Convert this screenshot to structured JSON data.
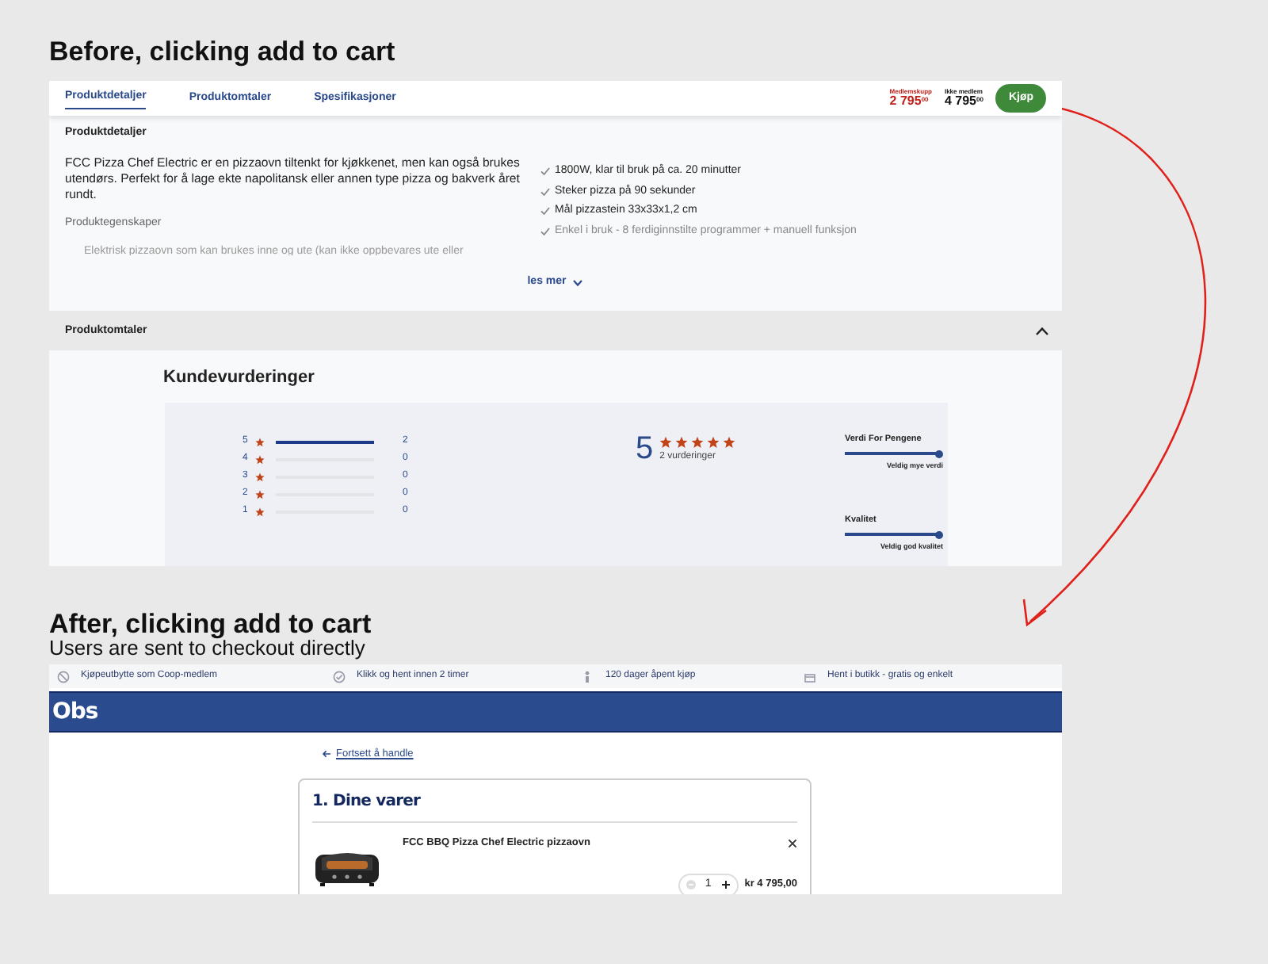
{
  "before": {
    "heading": "Before, clicking add to cart",
    "tabs": [
      {
        "label": "Produktdetaljer",
        "selected": true
      },
      {
        "label": "Produktomtaler",
        "selected": false
      },
      {
        "label": "Spesifikasjoner",
        "selected": false
      }
    ],
    "prices": [
      {
        "kind": "member",
        "label": "Medlemskupp",
        "price": "2 795$^{00}$"
      },
      {
        "kind": "regular",
        "label": "Ikke medlem",
        "price": "4 795$^{00}$"
      }
    ],
    "buy_button": "Kjøp",
    "details": {
      "title": "Produktdetaljer",
      "description": "FCC Pizza Chef Electric er en pizzaovn tiltenkt for kjøkkenet, men kan også brukes utendørs. Perfekt for å lage ekte napolitansk eller annen type pizza og bakverk året rundt.",
      "properties_label": "Produktegenskaper",
      "faded_bullet": "Elektrisk pizzaovn som kan brukes inne og ute (kan ikke oppbevares ute eller",
      "features": [
        {
          "text": "1800W, klar til bruk på ca. 20 minutter",
          "faded": false
        },
        {
          "text": "Steker pizza på 90 sekunder",
          "faded": false
        },
        {
          "text": "Mål pizzastein 33x33x1,2 cm",
          "faded": false
        },
        {
          "text": "Enkel i bruk - 8 ferdiginnstilte programmer + manuell funksjon",
          "faded": true
        }
      ],
      "more_link": "les mer"
    },
    "reviews_header": {
      "title": "Produktomtaler",
      "expanded": true
    },
    "ratings": {
      "title": "Kundevurderinger",
      "distribution": [
        {
          "stars_label": "5",
          "count": "2",
          "level": 1
        },
        {
          "stars_label": "4",
          "count": "0",
          "level": 0
        },
        {
          "stars_label": "3",
          "count": "0",
          "level": 0
        },
        {
          "stars_label": "2",
          "count": "0",
          "level": 0
        },
        {
          "stars_label": "1",
          "count": "0",
          "level": 0
        }
      ],
      "average": "5",
      "stars": 5,
      "count_label": "2 vurderinger",
      "attributes": [
        {
          "name": "Verdi For Pengene",
          "level": 1,
          "caption": "Veldig mye verdi"
        },
        {
          "name": "Kvalitet",
          "level": 1,
          "caption": "Veldig god kvalitet"
        }
      ]
    }
  },
  "after": {
    "heading": "After, clicking add to cart",
    "subtitle": "Users are sent to checkout directly",
    "usps": [
      "Kjøpeutbytte som Coop-medlem",
      "Klikk og hent innen 2 timer",
      "120 dager åpent kjøp",
      "Hent i butikk - gratis og enkelt"
    ],
    "logo": "Obs",
    "back_link": "Fortsett å handle",
    "cart": {
      "title": "1. Dine varer",
      "items": [
        {
          "name": "FCC BBQ Pizza Chef Electric pizzaovn",
          "quantity": "1",
          "price": "kr 4 795,00"
        }
      ]
    }
  }
}
